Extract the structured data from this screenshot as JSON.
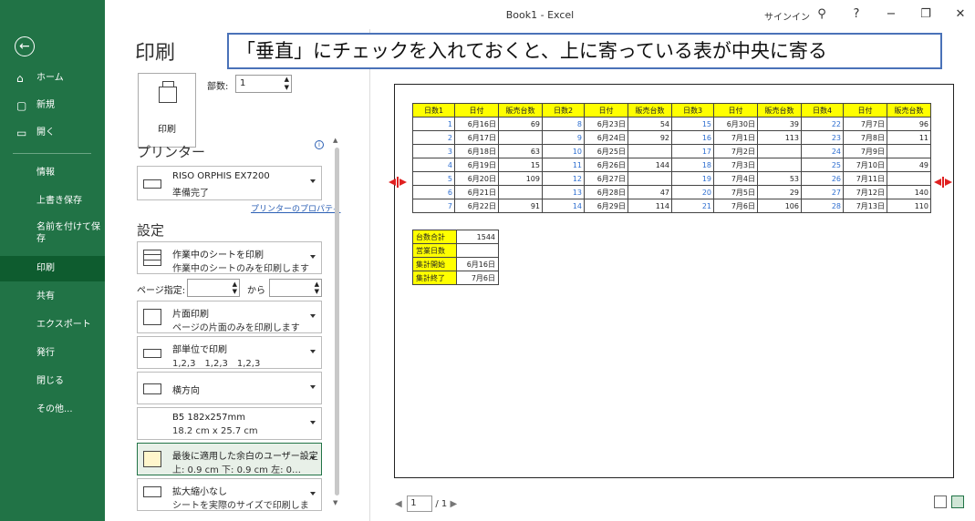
{
  "window": {
    "title": "Book1 - Excel",
    "signin": "サインイン",
    "help": "?",
    "minimize": "−",
    "restore": "❐",
    "close": "✕"
  },
  "nav": {
    "items": [
      {
        "label": "ホーム",
        "icon": "home-icon"
      },
      {
        "label": "新規",
        "icon": "new-file-icon"
      },
      {
        "label": "開く",
        "icon": "folder-open-icon"
      },
      {
        "label": "情報"
      },
      {
        "label": "上書き保存"
      },
      {
        "label": "名前を付けて保存"
      },
      {
        "label": "印刷"
      },
      {
        "label": "共有"
      },
      {
        "label": "エクスポート"
      },
      {
        "label": "発行"
      },
      {
        "label": "閉じる"
      },
      {
        "label": "その他..."
      }
    ]
  },
  "print": {
    "title": "印刷",
    "button_label": "印刷",
    "copies_label": "部数:",
    "copies_value": "1"
  },
  "printer": {
    "section_title": "プリンター",
    "name": "RISO ORPHIS EX7200",
    "status": "準備完了",
    "properties_link": "プリンターのプロパティ"
  },
  "settings": {
    "section_title": "設定",
    "what": {
      "l1": "作業中のシートを印刷",
      "l2": "作業中のシートのみを印刷します"
    },
    "pages_label": "ページ指定:",
    "pages_to": "から",
    "sides": {
      "l1": "片面印刷",
      "l2": "ページの片面のみを印刷します"
    },
    "collate": {
      "l1": "部単位で印刷",
      "l2": "1,2,3　1,2,3　1,2,3"
    },
    "orientation": {
      "l1": "横方向"
    },
    "paper": {
      "l1": "B5 182x257mm",
      "l2": "18.2 cm x 25.7 cm"
    },
    "margins": {
      "l1": "最後に適用した余白のユーザー設定",
      "l2": "上: 0.9 cm 下: 0.9 cm 左: 0…"
    },
    "scaling": {
      "l1": "拡大縮小なし",
      "l2": "シートを実際のサイズで印刷します"
    }
  },
  "callout": "「垂直」にチェックを入れておくと、上に寄っている表が中央に寄る",
  "sheet": {
    "headers": [
      "日数1",
      "日付",
      "販売台数",
      "日数2",
      "日付",
      "販売台数",
      "日数3",
      "日付",
      "販売台数",
      "日数4",
      "日付",
      "販売台数"
    ],
    "rows": [
      [
        "1",
        "6月16日",
        "69",
        "8",
        "6月23日",
        "54",
        "15",
        "6月30日",
        "39",
        "22",
        "7月7日",
        "96"
      ],
      [
        "2",
        "6月17日",
        "",
        "9",
        "6月24日",
        "92",
        "16",
        "7月1日",
        "113",
        "23",
        "7月8日",
        "11"
      ],
      [
        "3",
        "6月18日",
        "63",
        "10",
        "6月25日",
        "",
        "17",
        "7月2日",
        "",
        "24",
        "7月9日",
        ""
      ],
      [
        "4",
        "6月19日",
        "15",
        "11",
        "6月26日",
        "144",
        "18",
        "7月3日",
        "",
        "25",
        "7月10日",
        "49"
      ],
      [
        "5",
        "6月20日",
        "109",
        "12",
        "6月27日",
        "",
        "19",
        "7月4日",
        "53",
        "26",
        "7月11日",
        ""
      ],
      [
        "6",
        "6月21日",
        "",
        "13",
        "6月28日",
        "47",
        "20",
        "7月5日",
        "29",
        "27",
        "7月12日",
        "140"
      ],
      [
        "7",
        "6月22日",
        "91",
        "14",
        "6月29日",
        "114",
        "21",
        "7月6日",
        "106",
        "28",
        "7月13日",
        "110"
      ]
    ],
    "summary": [
      [
        "台数合計",
        "1544"
      ],
      [
        "営業日数",
        ""
      ],
      [
        "集計開始",
        "6月16日"
      ],
      [
        "集計終了",
        "7月6日"
      ]
    ]
  },
  "pager": {
    "current": "1",
    "total": "/ 1"
  }
}
